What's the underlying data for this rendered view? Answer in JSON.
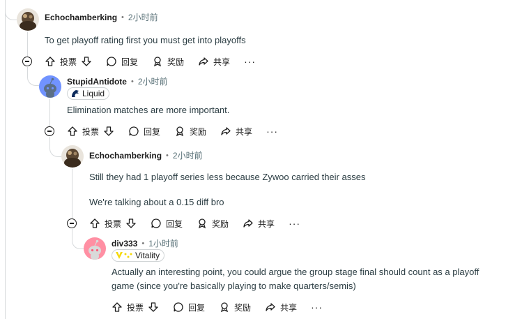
{
  "comments": [
    {
      "author": "Echochamberking",
      "time": "2小时前",
      "flair": "",
      "body": [
        "To get playoff rating first you must get into playoffs"
      ]
    },
    {
      "author": "StupidAntidote",
      "time": "2小时前",
      "flair": "Liquid",
      "body": [
        "Elimination matches are more important."
      ]
    },
    {
      "author": "Echochamberking",
      "time": "2小时前",
      "flair": "",
      "body": [
        "Still they had 1 playoff series less because Zywoo carried their asses",
        "We're talking about a 0.15 diff bro"
      ]
    },
    {
      "author": "div333",
      "time": "1小时前",
      "flair": "Vitality",
      "body": [
        "Actually an interesting point, you could argue the group stage final should count as a playoff game (since you're basically playing to make quarters/semis)"
      ]
    }
  ],
  "actions": {
    "vote": "投票",
    "reply": "回复",
    "award": "奖励",
    "share": "共享",
    "more": "···"
  },
  "colors": {
    "thread_line": "#d7dadc",
    "meta_gray": "#576f76",
    "avatar_blue": "#7193ff",
    "avatar_pink": "#ff8fa3",
    "vitality_yellow": "#f5d90a"
  }
}
